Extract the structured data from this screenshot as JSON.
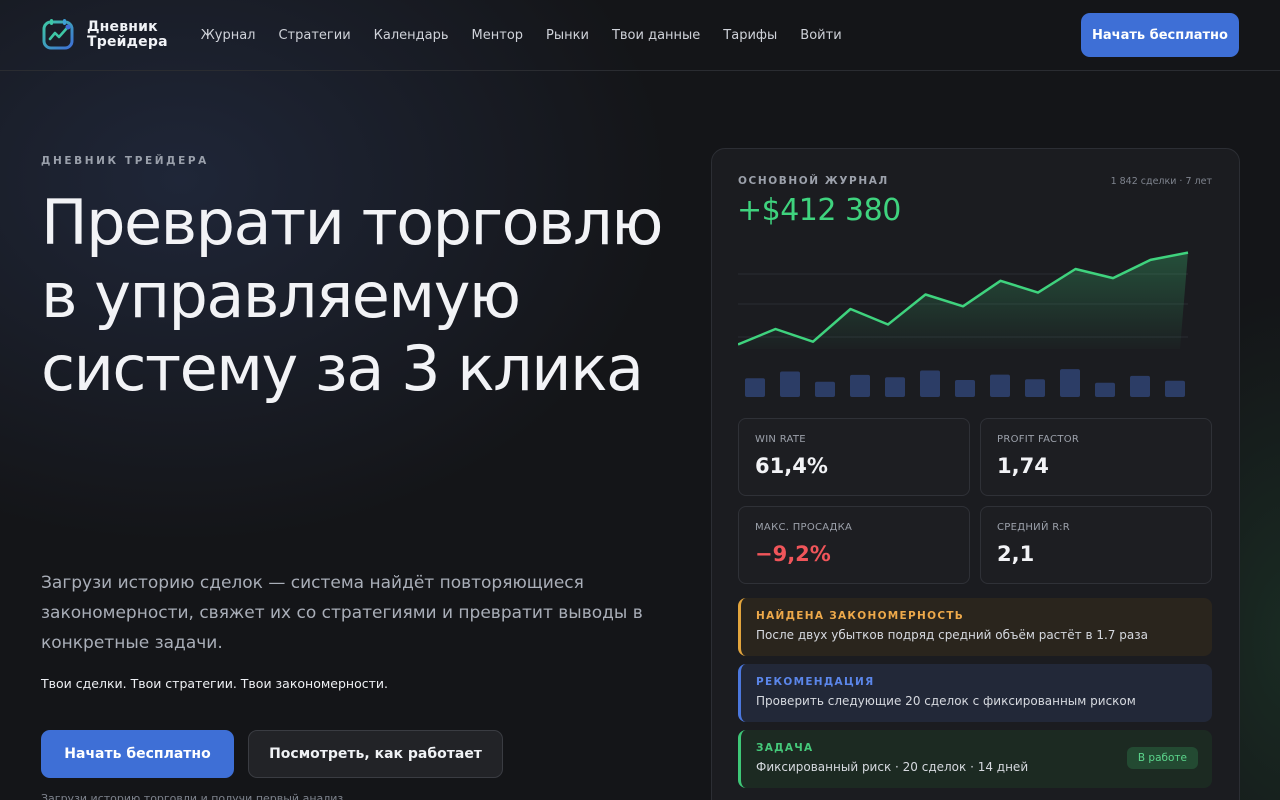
{
  "brand": {
    "line1": "Дневник",
    "line2": "Трейдера",
    "accent": "#3e6fd6"
  },
  "nav": [
    {
      "label": "Журнал"
    },
    {
      "label": "Стратегии"
    },
    {
      "label": "Календарь"
    },
    {
      "label": "Ментор"
    },
    {
      "label": "Рынки"
    },
    {
      "label": "Твои данные"
    },
    {
      "label": "Тарифы"
    },
    {
      "label": "Войти"
    }
  ],
  "header": {
    "cta_label": "Начать бесплатно"
  },
  "hero": {
    "eyebrow": "ДНЕВНИК ТРЕЙДЕРА",
    "title": "Преврати торговлю в управляемую систему за 3 клика",
    "subtitle": "Загрузи историю сделок — система найдёт повторяющиеся закономерности, свяжет их со стратегиями и превратит выводы в конкретные задачи.",
    "tagline": "Твои сделки. Твои стратегии. Твои закономерности.",
    "primary_cta": "Начать бесплатно",
    "secondary_cta": "Посмотреть, как работает",
    "footnote": "Загрузи историю торговли и получи первый анализ"
  },
  "panel": {
    "label": "ОСНОВНОЙ ЖУРНАЛ",
    "meta": "1 842 сделки · 7 лет",
    "total": "+$412 380",
    "stats": [
      {
        "label": "WIN RATE",
        "value": "61,4%"
      },
      {
        "label": "PROFIT FACTOR",
        "value": "1,74"
      },
      {
        "label": "МАКС. ПРОСАДКА",
        "value": "−9,2%"
      },
      {
        "label": "СРЕДНИЙ R:R",
        "value": "2,1"
      }
    ],
    "insights": [
      {
        "title": "НАЙДЕНА ЗАКОНОМЕРНОСТЬ",
        "text": "После двух убытков подряд средний объём растёт в 1.7 раза"
      },
      {
        "title": "РЕКОМЕНДАЦИЯ",
        "text": "Проверить следующие 20 сделок с фиксированным риском"
      },
      {
        "title": "ЗАДАЧА",
        "text": "Фиксированный риск · 20 сделок · 14 дней",
        "badge": "В работе"
      }
    ],
    "colors": {
      "positive": "#3fd37e",
      "negative": "#f0555a",
      "bars": "#2c3d66"
    }
  },
  "chart_data": {
    "type": "line",
    "title": "",
    "xlabel": "",
    "ylabel": "",
    "x": [
      1,
      2,
      3,
      4,
      5,
      6,
      7,
      8,
      9,
      10,
      11,
      12,
      13
    ],
    "values": [
      0.05,
      0.22,
      0.08,
      0.44,
      0.27,
      0.6,
      0.47,
      0.75,
      0.62,
      0.88,
      0.78,
      0.98,
      1.06
    ],
    "bar_values": [
      0.55,
      0.75,
      0.45,
      0.65,
      0.58,
      0.78,
      0.5,
      0.66,
      0.52,
      0.82,
      0.42,
      0.62,
      0.48
    ],
    "ylim": [
      0,
      1.1
    ],
    "grid": true,
    "legend": "none"
  }
}
